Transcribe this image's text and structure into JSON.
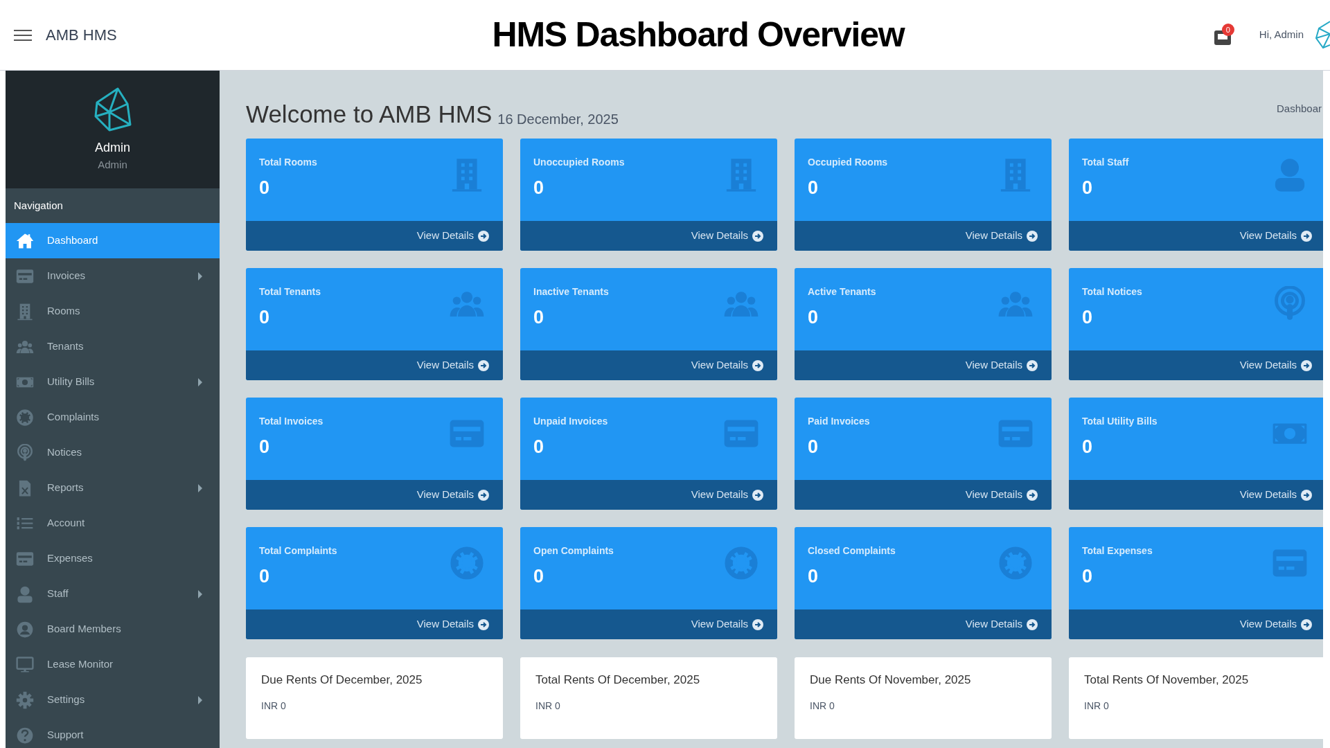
{
  "topbar": {
    "brand": "AMB HMS",
    "title": "HMS Dashboard Overview",
    "notification_count": "0",
    "greeting": "Hi, Admin"
  },
  "sidebar": {
    "user_name": "Admin",
    "user_role": "Admin",
    "section": "Navigation",
    "items": [
      {
        "label": "Dashboard",
        "selected": true,
        "submenu": false
      },
      {
        "label": "Invoices",
        "selected": false,
        "submenu": true
      },
      {
        "label": "Rooms",
        "selected": false,
        "submenu": false
      },
      {
        "label": "Tenants",
        "selected": false,
        "submenu": false
      },
      {
        "label": "Utility Bills",
        "selected": false,
        "submenu": true
      },
      {
        "label": "Complaints",
        "selected": false,
        "submenu": false
      },
      {
        "label": "Notices",
        "selected": false,
        "submenu": false
      },
      {
        "label": "Reports",
        "selected": false,
        "submenu": true
      },
      {
        "label": "Account",
        "selected": false,
        "submenu": false
      },
      {
        "label": "Expenses",
        "selected": false,
        "submenu": false
      },
      {
        "label": "Staff",
        "selected": false,
        "submenu": true
      },
      {
        "label": "Board Members",
        "selected": false,
        "submenu": false
      },
      {
        "label": "Lease Monitor",
        "selected": false,
        "submenu": false
      },
      {
        "label": "Settings",
        "selected": false,
        "submenu": true
      },
      {
        "label": "Support",
        "selected": false,
        "submenu": false
      }
    ]
  },
  "page": {
    "heading": "Welcome to AMB HMS",
    "date": "16 December, 2025",
    "breadcrumb": "Dashboar"
  },
  "stat_cards": [
    {
      "title": "Total Rooms",
      "value": "0",
      "link": "View Details"
    },
    {
      "title": "Unoccupied Rooms",
      "value": "0",
      "link": "View Details"
    },
    {
      "title": "Occupied Rooms",
      "value": "0",
      "link": "View Details"
    },
    {
      "title": "Total Staff",
      "value": "0",
      "link": "View Details"
    },
    {
      "title": "Total Tenants",
      "value": "0",
      "link": "View Details"
    },
    {
      "title": "Inactive Tenants",
      "value": "0",
      "link": "View Details"
    },
    {
      "title": "Active Tenants",
      "value": "0",
      "link": "View Details"
    },
    {
      "title": "Total Notices",
      "value": "0",
      "link": "View Details"
    },
    {
      "title": "Total Invoices",
      "value": "0",
      "link": "View Details"
    },
    {
      "title": "Unpaid Invoices",
      "value": "0",
      "link": "View Details"
    },
    {
      "title": "Paid Invoices",
      "value": "0",
      "link": "View Details"
    },
    {
      "title": "Total Utility Bills",
      "value": "0",
      "link": "View Details"
    },
    {
      "title": "Total Complaints",
      "value": "0",
      "link": "View Details"
    },
    {
      "title": "Open Complaints",
      "value": "0",
      "link": "View Details"
    },
    {
      "title": "Closed Complaints",
      "value": "0",
      "link": "View Details"
    },
    {
      "title": "Total Expenses",
      "value": "0",
      "link": "View Details"
    }
  ],
  "rent_cards": [
    {
      "title": "Due Rents Of December, 2025",
      "amount": "INR 0"
    },
    {
      "title": "Total Rents Of December, 2025",
      "amount": "INR 0"
    },
    {
      "title": "Due Rents Of November, 2025",
      "amount": "INR 0"
    },
    {
      "title": "Total Rents Of November, 2025",
      "amount": "INR 0"
    }
  ]
}
